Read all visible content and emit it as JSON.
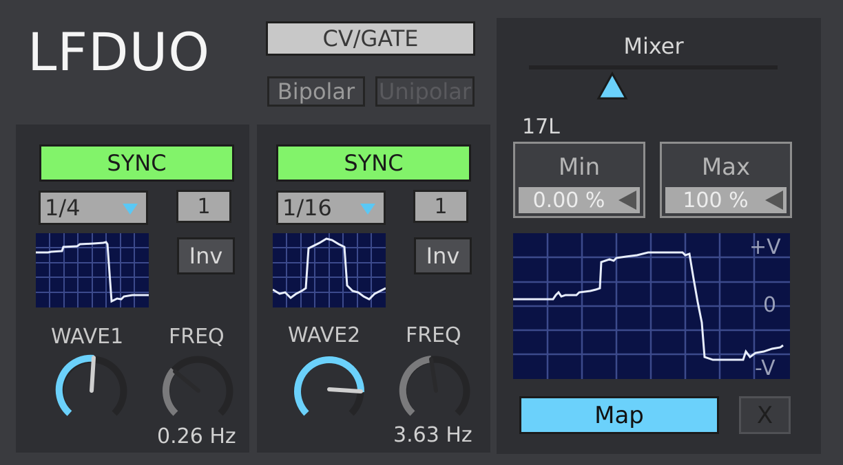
{
  "app": {
    "title": "LFDUO"
  },
  "mode": {
    "cv_gate_label": "CV/GATE",
    "bipolar_label": "Bipolar",
    "unipolar_label": "Unipolar"
  },
  "lfo1": {
    "sync_label": "SYNC",
    "rate": "1/4",
    "multiplier": "1",
    "invert_label": "Inv",
    "wave_label": "WAVE1",
    "freq_label": "FREQ",
    "freq_value": "0.26 Hz"
  },
  "lfo2": {
    "sync_label": "SYNC",
    "rate": "1/16",
    "multiplier": "1",
    "invert_label": "Inv",
    "wave_label": "WAVE2",
    "freq_label": "FREQ",
    "freq_value": "3.63 Hz"
  },
  "mixer": {
    "title": "Mixer",
    "value": "17L",
    "min_label": "Min",
    "min_value": "0.00 %",
    "max_label": "Max",
    "max_value": "100 %",
    "scope_top": "+V",
    "scope_mid": "0",
    "scope_bottom": "-V",
    "map_label": "Map",
    "clear_label": "X"
  },
  "colors": {
    "accent_blue": "#6bd1fb",
    "sync_green": "#82f36a",
    "scope_bg": "#0a1245"
  }
}
